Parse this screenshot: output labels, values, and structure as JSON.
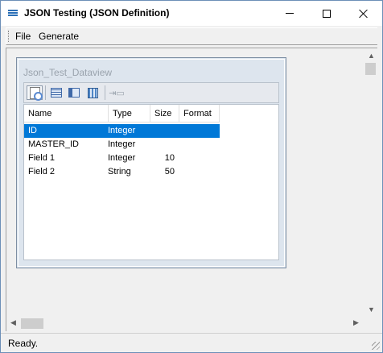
{
  "window": {
    "title": "JSON Testing (JSON Definition)",
    "icon": "app-list-icon"
  },
  "menu": {
    "items": [
      "File",
      "Generate"
    ]
  },
  "dataview": {
    "title": "Json_Test_Dataview",
    "toolbar_icons": [
      "inspect-icon",
      "grid-icon",
      "grid-columns-icon",
      "calculator-icon",
      "insert-icon"
    ]
  },
  "grid": {
    "columns": [
      "Name",
      "Type",
      "Size",
      "Format"
    ],
    "rows": [
      {
        "name": "ID",
        "type": "Integer",
        "size": "",
        "format": ""
      },
      {
        "name": "MASTER_ID",
        "type": "Integer",
        "size": "",
        "format": ""
      },
      {
        "name": "Field 1",
        "type": "Integer",
        "size": "10",
        "format": ""
      },
      {
        "name": "Field 2",
        "type": "String",
        "size": "50",
        "format": ""
      }
    ],
    "selected_row": 0
  },
  "status": {
    "text": "Ready."
  },
  "colors": {
    "selection": "#0078d7",
    "accent": "#2b6fb6"
  }
}
